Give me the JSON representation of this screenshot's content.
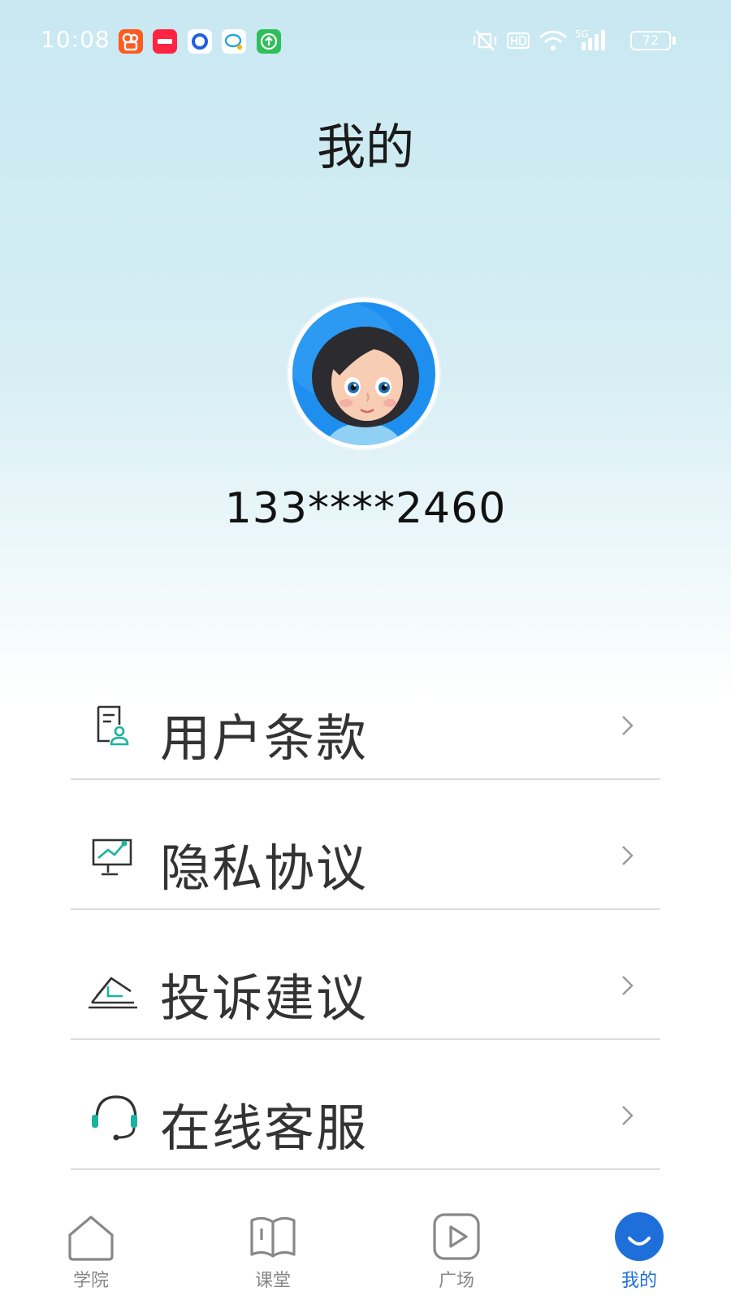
{
  "status_bar": {
    "time": "10:08",
    "notifications": [
      "kuaishou-app-icon",
      "xiaohongshu-app-icon",
      "app-circle-icon",
      "chat-app-icon",
      "upload-app-icon"
    ],
    "network": "5G",
    "battery": "72"
  },
  "header": {
    "title": "我的"
  },
  "profile": {
    "phone": "133****2460"
  },
  "menu": {
    "items": [
      {
        "label": "用户条款",
        "icon": "user-terms-icon"
      },
      {
        "label": "隐私协议",
        "icon": "privacy-chart-icon"
      },
      {
        "label": "投诉建议",
        "icon": "feedback-envelope-icon"
      },
      {
        "label": "在线客服",
        "icon": "headset-icon"
      }
    ]
  },
  "nav": {
    "items": [
      {
        "label": "学院",
        "icon": "home-icon"
      },
      {
        "label": "课堂",
        "icon": "book-icon"
      },
      {
        "label": "广场",
        "icon": "play-icon"
      },
      {
        "label": "我的",
        "icon": "smile-icon",
        "active": true
      }
    ]
  },
  "colors": {
    "accent": "#1e6fd9",
    "teal": "#19b3a0",
    "text": "#333333"
  }
}
